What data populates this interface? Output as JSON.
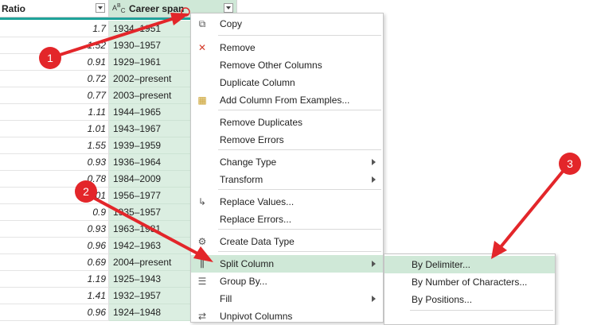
{
  "columns": {
    "ratio_header": "Ratio",
    "career_header": "Career span",
    "career_type_icon": "abc-text-type-icon"
  },
  "rows": [
    {
      "ratio": "1.7",
      "career": "1934–1951"
    },
    {
      "ratio": "1.52",
      "career": "1930–1957"
    },
    {
      "ratio": "0.91",
      "career": "1929–1961"
    },
    {
      "ratio": "0.72",
      "career": "2002–present"
    },
    {
      "ratio": "0.77",
      "career": "2003–present"
    },
    {
      "ratio": "1.11",
      "career": "1944–1965"
    },
    {
      "ratio": "1.01",
      "career": "1943–1967"
    },
    {
      "ratio": "1.55",
      "career": "1939–1959"
    },
    {
      "ratio": "0.93",
      "career": "1936–1964"
    },
    {
      "ratio": "0.78",
      "career": "1984–2009"
    },
    {
      "ratio": "1.01",
      "career": "1956–1977"
    },
    {
      "ratio": "0.9",
      "career": "1935–1957"
    },
    {
      "ratio": "0.93",
      "career": "1963–1981"
    },
    {
      "ratio": "0.96",
      "career": "1942–1963"
    },
    {
      "ratio": "0.69",
      "career": "2004–present"
    },
    {
      "ratio": "1.19",
      "career": "1925–1943"
    },
    {
      "ratio": "1.41",
      "career": "1932–1957"
    },
    {
      "ratio": "0.96",
      "career": "1924–1948"
    }
  ],
  "menu": {
    "items": [
      {
        "label": "Copy",
        "icon": "copy-icon"
      },
      {
        "label": "Remove",
        "icon": "remove-x-icon"
      },
      {
        "label": "Remove Other Columns",
        "icon": ""
      },
      {
        "label": "Duplicate Column",
        "icon": ""
      },
      {
        "label": "Add Column From Examples...",
        "icon": "column-from-examples-icon"
      },
      {
        "label": "Remove Duplicates",
        "icon": ""
      },
      {
        "label": "Remove Errors",
        "icon": ""
      },
      {
        "label": "Change Type",
        "icon": "",
        "submenu": true
      },
      {
        "label": "Transform",
        "icon": "",
        "submenu": true
      },
      {
        "label": "Replace Values...",
        "icon": "replace-values-icon"
      },
      {
        "label": "Replace Errors...",
        "icon": ""
      },
      {
        "label": "Create Data Type",
        "icon": "data-type-icon"
      },
      {
        "label": "Split Column",
        "icon": "split-column-icon",
        "submenu": true,
        "highlighted": true
      },
      {
        "label": "Group By...",
        "icon": "group-by-icon"
      },
      {
        "label": "Fill",
        "icon": "",
        "submenu": true
      },
      {
        "label": "Unpivot Columns",
        "icon": "unpivot-icon"
      }
    ]
  },
  "submenu": {
    "items": [
      {
        "label": "By Delimiter...",
        "highlighted": true
      },
      {
        "label": "By Number of Characters..."
      },
      {
        "label": "By Positions..."
      }
    ]
  },
  "callouts": [
    "1",
    "2",
    "3"
  ],
  "colors": {
    "accent_teal": "#1fa39a",
    "selected_column": "#dbeee1",
    "highlight": "#cfe8d7",
    "annotation_red": "#e3262a"
  }
}
